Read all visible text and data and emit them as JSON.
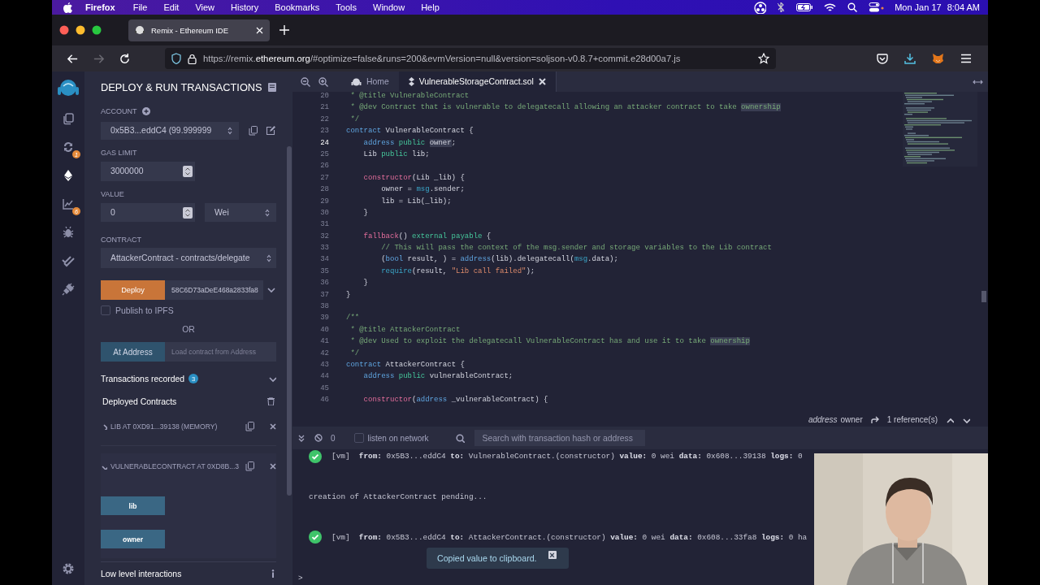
{
  "menubar": {
    "app": "Firefox",
    "items": [
      "File",
      "Edit",
      "View",
      "History",
      "Bookmarks",
      "Tools",
      "Window",
      "Help"
    ],
    "date": "Mon Jan 17",
    "time": "8:04 AM"
  },
  "browser": {
    "tabs": [
      {
        "title": "Remix - Ethereum IDE",
        "selected": true
      }
    ],
    "nav_buttons": [
      {
        "kind": "back",
        "disabled": false
      },
      {
        "kind": "forward",
        "disabled": true
      },
      {
        "kind": "reload",
        "disabled": false
      }
    ],
    "url_parts": [
      {
        "text": "https://remix.",
        "emphasis": false
      },
      {
        "text": "ethereum.org",
        "emphasis": true
      },
      {
        "text": "/#optimize=false&runs=200&evmVersion=null&version=soljson-v0.8.7+commit.e28d00a7.js",
        "emphasis": false
      }
    ]
  },
  "icon_bar": {
    "items": [
      {
        "kind": "files",
        "selected": false
      },
      {
        "kind": "compiler",
        "badge": "1",
        "selected": false
      },
      {
        "kind": "deploy",
        "selected": true
      },
      {
        "kind": "analysis",
        "badge": "6",
        "selected": false
      },
      {
        "kind": "debugger",
        "selected": false
      },
      {
        "kind": "tests",
        "selected": false
      },
      {
        "kind": "plugins",
        "selected": false
      }
    ]
  },
  "side_panel": {
    "title": "DEPLOY & RUN TRANSACTIONS",
    "account_label": "ACCOUNT",
    "account": "0x5B3...eddC4 (99.999999",
    "gas_limit_label": "GAS LIMIT",
    "gas_limit": "3000000",
    "value_label": "VALUE",
    "value": "0",
    "unit": "Wei",
    "contract_label": "CONTRACT",
    "contract": "AttackerContract - contracts/delegate",
    "deploy_button": "Deploy",
    "deploy_args": "58C6D73aDeE468a2833fa8",
    "publish_ipfs": {
      "label": "Publish to IPFS",
      "checked": false
    },
    "or": "OR",
    "at_address_button": "At Address",
    "at_address_placeholder": "Load contract from Address",
    "transactions_recorded": "Transactions recorded",
    "transactions_count": "3",
    "deployed_contracts": "Deployed Contracts",
    "instances": [
      {
        "title": "LIB AT 0XD91...39138 (MEMORY)",
        "expanded": false
      },
      {
        "title": "VULNERABLECONTRACT AT 0XD8B...3",
        "expanded": true,
        "functions": [
          "lib",
          "owner"
        ]
      }
    ],
    "low_level": "Low level interactions"
  },
  "editor": {
    "tabs": [
      {
        "label": "Home",
        "kind": "home",
        "selected": false
      },
      {
        "label": "VulnerableStorageContract.sol",
        "kind": "file",
        "selected": true
      }
    ],
    "lines": [
      {
        "number": "20",
        "current": false,
        "tokens": [
          {
            "kind": "comment",
            "text": " * @title VulnerableContract"
          }
        ]
      },
      {
        "number": "21",
        "current": false,
        "tokens": [
          {
            "kind": "comment",
            "text": " * @dev Contract that is vulnerable to delegatecall allowing an attacker contract to take "
          },
          {
            "kind": "comment",
            "text": "ownership",
            "match": true
          }
        ]
      },
      {
        "number": "22",
        "current": false,
        "tokens": [
          {
            "kind": "comment",
            "text": " */"
          }
        ]
      },
      {
        "number": "23",
        "current": false,
        "tokens": [
          {
            "kind": "keyword",
            "text": "contract"
          },
          {
            "kind": "plain",
            "text": " VulnerableContract {"
          }
        ]
      },
      {
        "number": "24",
        "current": true,
        "tokens": [
          {
            "kind": "keyword",
            "text": "    address"
          },
          {
            "kind": "modifier",
            "text": " public "
          },
          {
            "kind": "plain",
            "text": "owner",
            "match": true
          },
          {
            "kind": "plain",
            "text": ";"
          }
        ]
      },
      {
        "number": "25",
        "current": false,
        "tokens": [
          {
            "kind": "plain",
            "text": "    Lib "
          },
          {
            "kind": "modifier",
            "text": "public"
          },
          {
            "kind": "plain",
            "text": " lib;"
          }
        ]
      },
      {
        "number": "26",
        "current": false
      },
      {
        "number": "27",
        "current": false,
        "tokens": [
          {
            "kind": "function",
            "text": "    constructor"
          },
          {
            "kind": "plain",
            "text": "(Lib _lib) {"
          }
        ]
      },
      {
        "number": "28",
        "current": false,
        "tokens": [
          {
            "kind": "plain",
            "text": "        owner = "
          },
          {
            "kind": "builtin",
            "text": "msg"
          },
          {
            "kind": "plain",
            "text": ".sender;"
          }
        ]
      },
      {
        "number": "29",
        "current": false,
        "tokens": [
          {
            "kind": "plain",
            "text": "        lib = Lib(_lib);"
          }
        ]
      },
      {
        "number": "30",
        "current": false,
        "tokens": [
          {
            "kind": "plain",
            "text": "    }"
          }
        ]
      },
      {
        "number": "31",
        "current": false
      },
      {
        "number": "32",
        "current": false,
        "tokens": [
          {
            "kind": "function",
            "text": "    fallback"
          },
          {
            "kind": "plain",
            "text": "() "
          },
          {
            "kind": "modifier",
            "text": "external payable"
          },
          {
            "kind": "plain",
            "text": " {"
          }
        ]
      },
      {
        "number": "33",
        "current": false,
        "tokens": [
          {
            "kind": "comment",
            "text": "        // This will pass the context of the msg.sender and storage variables to the Lib contract"
          }
        ]
      },
      {
        "number": "34",
        "current": false,
        "tokens": [
          {
            "kind": "plain",
            "text": "        ("
          },
          {
            "kind": "keyword",
            "text": "bool"
          },
          {
            "kind": "plain",
            "text": " result, ) = "
          },
          {
            "kind": "keyword",
            "text": "address"
          },
          {
            "kind": "plain",
            "text": "(lib).delegatecall("
          },
          {
            "kind": "builtin",
            "text": "msg"
          },
          {
            "kind": "plain",
            "text": ".data);"
          }
        ]
      },
      {
        "number": "35",
        "current": false,
        "tokens": [
          {
            "kind": "builtin",
            "text": "        require"
          },
          {
            "kind": "plain",
            "text": "(result, "
          },
          {
            "kind": "string",
            "text": "\"Lib call failed\""
          },
          {
            "kind": "plain",
            "text": ");"
          }
        ]
      },
      {
        "number": "36",
        "current": false,
        "tokens": [
          {
            "kind": "plain",
            "text": "    }"
          }
        ]
      },
      {
        "number": "37",
        "current": false,
        "tokens": [
          {
            "kind": "plain",
            "text": "}"
          }
        ]
      },
      {
        "number": "38",
        "current": false
      },
      {
        "number": "39",
        "current": false,
        "tokens": [
          {
            "kind": "comment",
            "text": "/**"
          }
        ]
      },
      {
        "number": "40",
        "current": false,
        "tokens": [
          {
            "kind": "comment",
            "text": " * @title AttackerContract"
          }
        ]
      },
      {
        "number": "41",
        "current": false,
        "tokens": [
          {
            "kind": "comment",
            "text": " * @dev Used to exploit the delegatecall VulnerableContract has and use it to take "
          },
          {
            "kind": "comment",
            "text": "ownership",
            "match": true
          }
        ]
      },
      {
        "number": "42",
        "current": false,
        "tokens": [
          {
            "kind": "comment",
            "text": " */"
          }
        ]
      },
      {
        "number": "43",
        "current": false,
        "tokens": [
          {
            "kind": "keyword",
            "text": "contract"
          },
          {
            "kind": "plain",
            "text": " AttackerContract {"
          }
        ]
      },
      {
        "number": "44",
        "current": false,
        "tokens": [
          {
            "kind": "keyword",
            "text": "    address"
          },
          {
            "kind": "modifier",
            "text": " public"
          },
          {
            "kind": "plain",
            "text": " vulnerableContract;"
          }
        ]
      },
      {
        "number": "45",
        "current": false
      },
      {
        "number": "46",
        "current": false,
        "tokens": [
          {
            "kind": "function",
            "text": "    constructor"
          },
          {
            "kind": "plain",
            "text": "("
          },
          {
            "kind": "keyword",
            "text": "address"
          },
          {
            "kind": "plain",
            "text": " _vulnerableContract) {"
          }
        ]
      }
    ],
    "references": {
      "declaration_type": "address",
      "name": "owner",
      "count": "1 reference(s)"
    }
  },
  "terminal": {
    "pending_count": "0",
    "listen_on_network": {
      "label": "listen on network",
      "checked": false
    },
    "search_placeholder": "Search with transaction hash or address",
    "logs": [
      {
        "kind": "tx",
        "text": "[vm]  **from:** 0x5B3...eddC4 **to:** VulnerableContract.(constructor) **value:** 0 wei **data:** 0x608...39138 **logs:** 0"
      },
      {
        "kind": "text",
        "text": "creation of AttackerContract pending..."
      },
      {
        "kind": "tx",
        "text": "[vm]  **from:** 0x5B3...eddC4 **to:** AttackerContract.(constructor) **value:** 0 wei **data:** 0x608...33fa8 **logs:** 0 ha"
      }
    ],
    "prompt": ">"
  },
  "toast": {
    "text": "Copied value to clipboard.",
    "close": "×"
  }
}
